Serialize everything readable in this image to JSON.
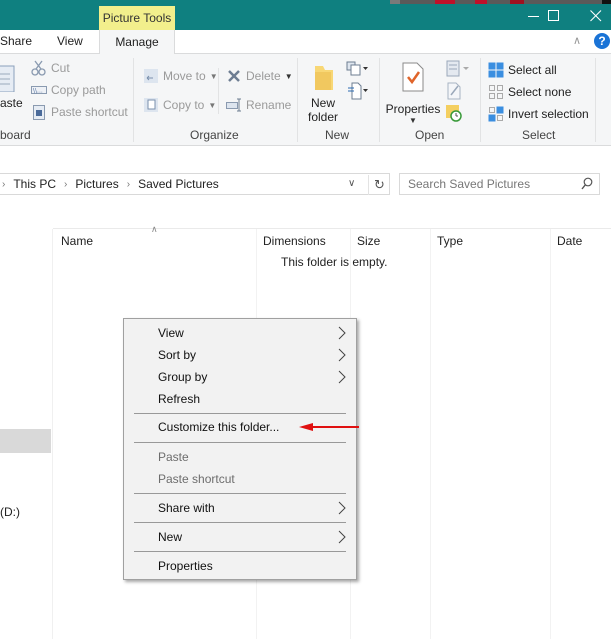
{
  "titlebar": {
    "contextual_tab": "Picture Tools",
    "minimize_icon": "minimize-icon",
    "maximize_icon": "maximize-icon",
    "close_icon": "close-icon",
    "background": "#0f8080",
    "contextual_tab_color": "#f2ef8c"
  },
  "ribbon_tabs": {
    "share": "Share",
    "view": "View",
    "manage": "Manage",
    "collapse_icon": "chevron-up-icon",
    "help_icon": "help-icon"
  },
  "ribbon": {
    "clipboard": {
      "label": "board",
      "paste": "aste",
      "cut": "Cut",
      "copy_path": "Copy path",
      "paste_shortcut": "Paste shortcut"
    },
    "organize": {
      "label": "Organize",
      "move_to": "Move to",
      "copy_to": "Copy to",
      "delete": "Delete",
      "rename": "Rename"
    },
    "new": {
      "label": "New",
      "new_folder_line1": "New",
      "new_folder_line2": "folder"
    },
    "open": {
      "label": "Open",
      "properties": "Properties"
    },
    "select": {
      "label": "Select",
      "select_all": "Select all",
      "select_none": "Select none",
      "invert_selection": "Invert selection"
    }
  },
  "address": {
    "crumbs": [
      "This PC",
      "Pictures",
      "Saved Pictures"
    ],
    "search_placeholder": "Search Saved Pictures"
  },
  "nav": {
    "drive_label": "(D:)"
  },
  "columns": {
    "name": "Name",
    "dimensions": "Dimensions",
    "size": "Size",
    "type": "Type",
    "date": "Date"
  },
  "content": {
    "empty_message": "This folder is empty."
  },
  "context_menu": {
    "items": [
      {
        "label": "View",
        "submenu": true,
        "enabled": true
      },
      {
        "label": "Sort by",
        "submenu": true,
        "enabled": true
      },
      {
        "label": "Group by",
        "submenu": true,
        "enabled": true
      },
      {
        "label": "Refresh",
        "submenu": false,
        "enabled": true
      },
      {
        "label": "Customize this folder...",
        "submenu": false,
        "enabled": true
      },
      {
        "label": "Paste",
        "submenu": false,
        "enabled": false
      },
      {
        "label": "Paste shortcut",
        "submenu": false,
        "enabled": false
      },
      {
        "label": "Share with",
        "submenu": true,
        "enabled": true
      },
      {
        "label": "New",
        "submenu": true,
        "enabled": true
      },
      {
        "label": "Properties",
        "submenu": false,
        "enabled": true
      }
    ],
    "annotation_arrow_color": "#e01010"
  }
}
